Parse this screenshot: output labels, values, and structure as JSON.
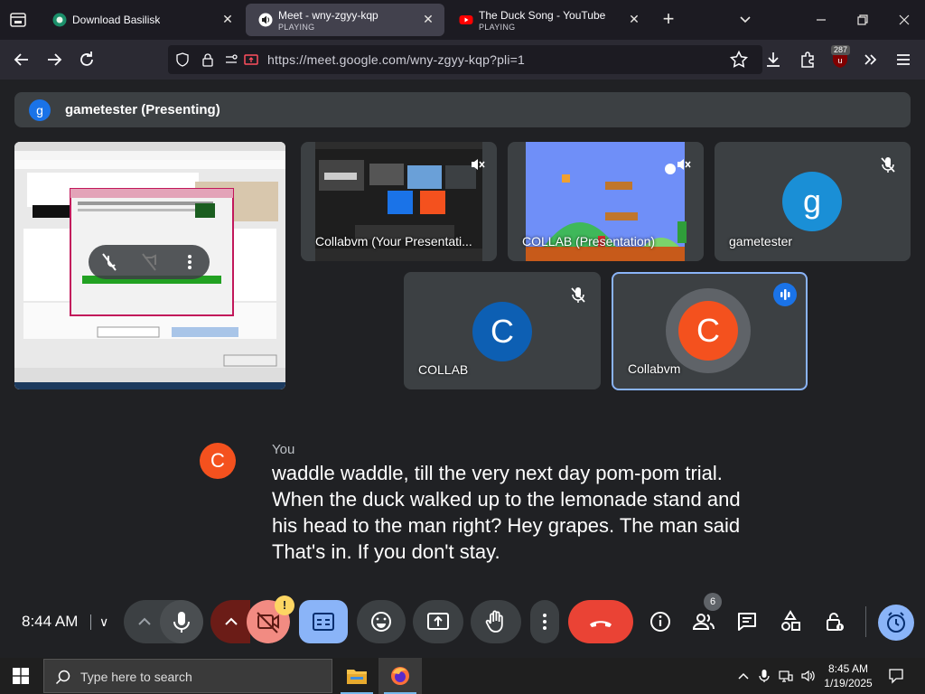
{
  "browser": {
    "tabs": [
      {
        "title": "Download Basilisk",
        "status": ""
      },
      {
        "title": "Meet - wny-zgyy-kqp",
        "status": "PLAYING"
      },
      {
        "title": "The Duck Song - YouTube",
        "status": "PLAYING"
      }
    ],
    "url": "https://meet.google.com/wny-zgyy-kqp?pli=1",
    "extension_badge": "287"
  },
  "meet": {
    "presenting_banner": {
      "avatar_letter": "g",
      "text": "gametester (Presenting)"
    },
    "tiles": [
      {
        "name": "Collabvm (Your Presentati...",
        "muted": true,
        "kind": "screen"
      },
      {
        "name": "COLLAB (Presentation)",
        "muted": true,
        "kind": "screen"
      },
      {
        "name": "gametester",
        "avatar_letter": "g",
        "muted": true,
        "avatar_color": "#1a73e8"
      },
      {
        "name": "COLLAB",
        "avatar_letter": "C",
        "muted": true,
        "avatar_color": "#1565c0"
      },
      {
        "name": "Collabvm",
        "avatar_letter": "C",
        "speaking": true,
        "avatar_color": "#f4511e"
      }
    ],
    "caption": {
      "avatar_letter": "C",
      "speaker": "You",
      "text": "waddle waddle, till the very next day pom-pom trial. When the duck walked up to the lemonade stand and his head to the man right? Hey grapes. The man said That's in. If you don't stay."
    },
    "controls": {
      "time": "8:44 AM",
      "code_chevron": "∨",
      "warning_mark": "!",
      "participant_count": "6"
    }
  },
  "taskbar": {
    "search_placeholder": "Type here to search",
    "time": "8:45 AM",
    "date": "1/19/2025"
  },
  "colors": {
    "meet_bg": "#202124",
    "hangup": "#ea4335",
    "active_accent": "#8ab4f8",
    "camera_off": "#f28b82"
  }
}
